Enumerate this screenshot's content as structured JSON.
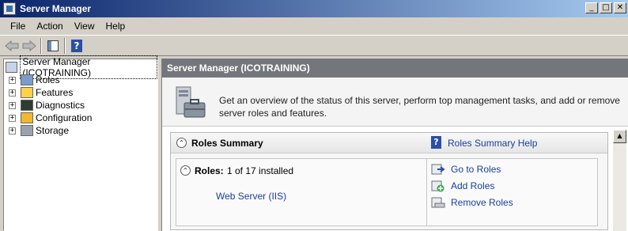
{
  "window": {
    "title": "Server Manager",
    "controls": {
      "minimize": "_",
      "maximize": "□",
      "close": "✕"
    }
  },
  "menu": [
    "File",
    "Action",
    "View",
    "Help"
  ],
  "toolbar": {
    "back_icon": "back-arrow-icon",
    "forward_icon": "forward-arrow-icon",
    "console_icon": "show-hide-console-tree-icon",
    "help_icon": "help-icon",
    "help_glyph": "?"
  },
  "tree": {
    "root": "Server Manager (ICOTRAINING)",
    "items": [
      {
        "label": "Roles",
        "icon": "roles-icon",
        "expander": "+"
      },
      {
        "label": "Features",
        "icon": "features-icon",
        "expander": "+"
      },
      {
        "label": "Diagnostics",
        "icon": "diagnostics-icon",
        "expander": "+"
      },
      {
        "label": "Configuration",
        "icon": "configuration-icon",
        "expander": "+"
      },
      {
        "label": "Storage",
        "icon": "storage-icon",
        "expander": "+"
      }
    ]
  },
  "main": {
    "header": "Server Manager (ICOTRAINING)",
    "overview": "Get an overview of the status of this server, perform top management tasks, and add or remove server roles and features.",
    "roles_summary": {
      "title": "Roles Summary",
      "collapse_glyph": "⌃",
      "help_link": "Roles Summary Help",
      "roles_label": "Roles:",
      "roles_count": "1 of 17 installed",
      "installed_roles": [
        "Web Server (IIS)"
      ],
      "actions": [
        "Go to Roles",
        "Add Roles",
        "Remove Roles"
      ]
    }
  },
  "scrollbar": {
    "up_glyph": "▲"
  },
  "colors": {
    "title_gradient_start": "#0a246a",
    "title_gradient_end": "#a6caf0",
    "header_gray": "#73767a",
    "link_blue": "#1a3e9c"
  }
}
